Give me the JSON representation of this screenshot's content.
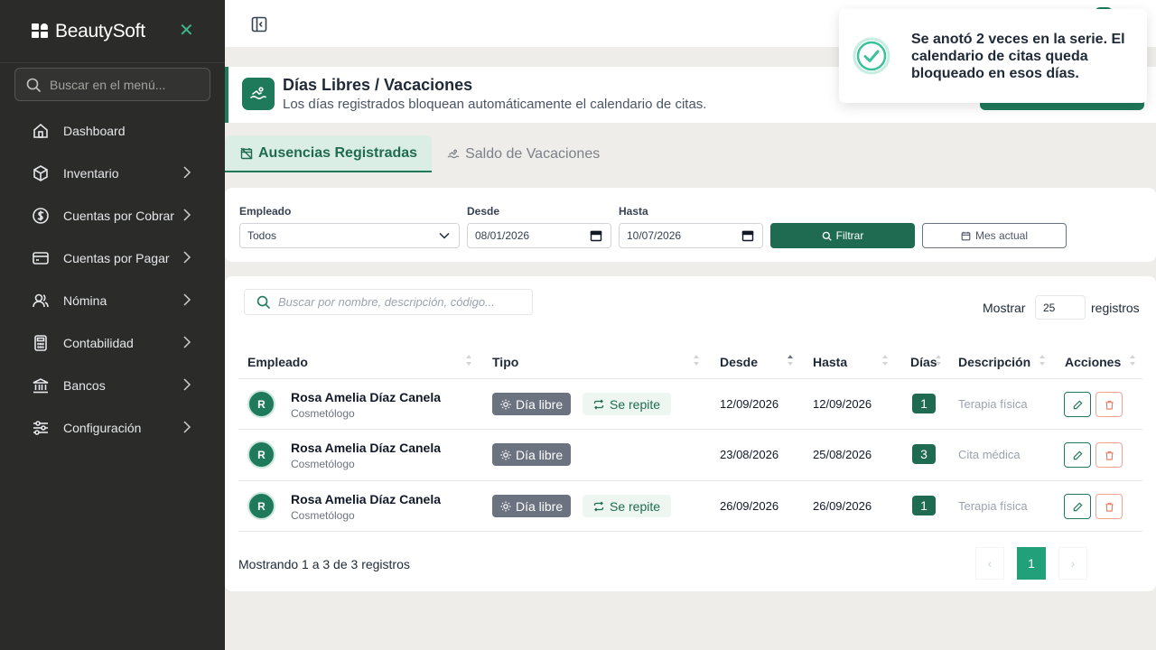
{
  "app": {
    "brand": "BeautySoft",
    "accent": "#1f7a5c"
  },
  "sidebar": {
    "search_placeholder": "Buscar en el menú...",
    "items": [
      {
        "label": "Dashboard",
        "icon": "home-icon"
      },
      {
        "label": "Inventario",
        "icon": "box-icon"
      },
      {
        "label": "Cuentas por Cobrar",
        "icon": "dollar-circle-icon"
      },
      {
        "label": "Cuentas por Pagar",
        "icon": "credit-card-icon"
      },
      {
        "label": "Nómina",
        "icon": "users-icon"
      },
      {
        "label": "Contabilidad",
        "icon": "calculator-icon"
      },
      {
        "label": "Bancos",
        "icon": "bank-icon"
      },
      {
        "label": "Configuración",
        "icon": "sliders-icon"
      }
    ]
  },
  "header": {
    "title": "Días Libres / Vacaciones",
    "subtitle": "Los días registrados bloquean automáticamente el calendario de citas."
  },
  "tabs": [
    {
      "label": "Ausencias Registradas",
      "active": true
    },
    {
      "label": "Saldo de Vacaciones",
      "active": false
    }
  ],
  "filters": {
    "employee_label": "Empleado",
    "employee_value": "Todos",
    "from_label": "Desde",
    "from_value": "08/01/2026",
    "to_label": "Hasta",
    "to_value": "10/07/2026",
    "filter_button": "Filtrar",
    "month_button": "Mes actual"
  },
  "table": {
    "search_placeholder": "Buscar por nombre, descripción, código...",
    "show_label": "Mostrar",
    "show_value": "25",
    "show_suffix": "registros",
    "columns": [
      "Empleado",
      "Tipo",
      "Desde",
      "Hasta",
      "Días",
      "Descripción",
      "Acciones"
    ],
    "rows": [
      {
        "initial": "R",
        "name": "Rosa Amelia Díaz Canela",
        "role": "Cosmetólogo",
        "type": "Día libre",
        "repeat": "Se repite",
        "from": "12/09/2026",
        "to": "12/09/2026",
        "days": "1",
        "description": "Terapia física"
      },
      {
        "initial": "R",
        "name": "Rosa Amelia Díaz Canela",
        "role": "Cosmetólogo",
        "type": "Día libre",
        "repeat": "",
        "from": "23/08/2026",
        "to": "25/08/2026",
        "days": "3",
        "description": "Cita médica"
      },
      {
        "initial": "R",
        "name": "Rosa Amelia Díaz Canela",
        "role": "Cosmetólogo",
        "type": "Día libre",
        "repeat": "Se repite",
        "from": "26/09/2026",
        "to": "26/09/2026",
        "days": "1",
        "description": "Terapia física"
      }
    ],
    "footer": "Mostrando 1 a 3 de 3 registros",
    "pagination": {
      "prev": "‹",
      "current": "1",
      "next": "›"
    }
  },
  "toast": {
    "message": "Se anotó 2 veces en la serie. El calendario de citas queda bloqueado en esos días.",
    "icon": "check-circle-icon"
  }
}
